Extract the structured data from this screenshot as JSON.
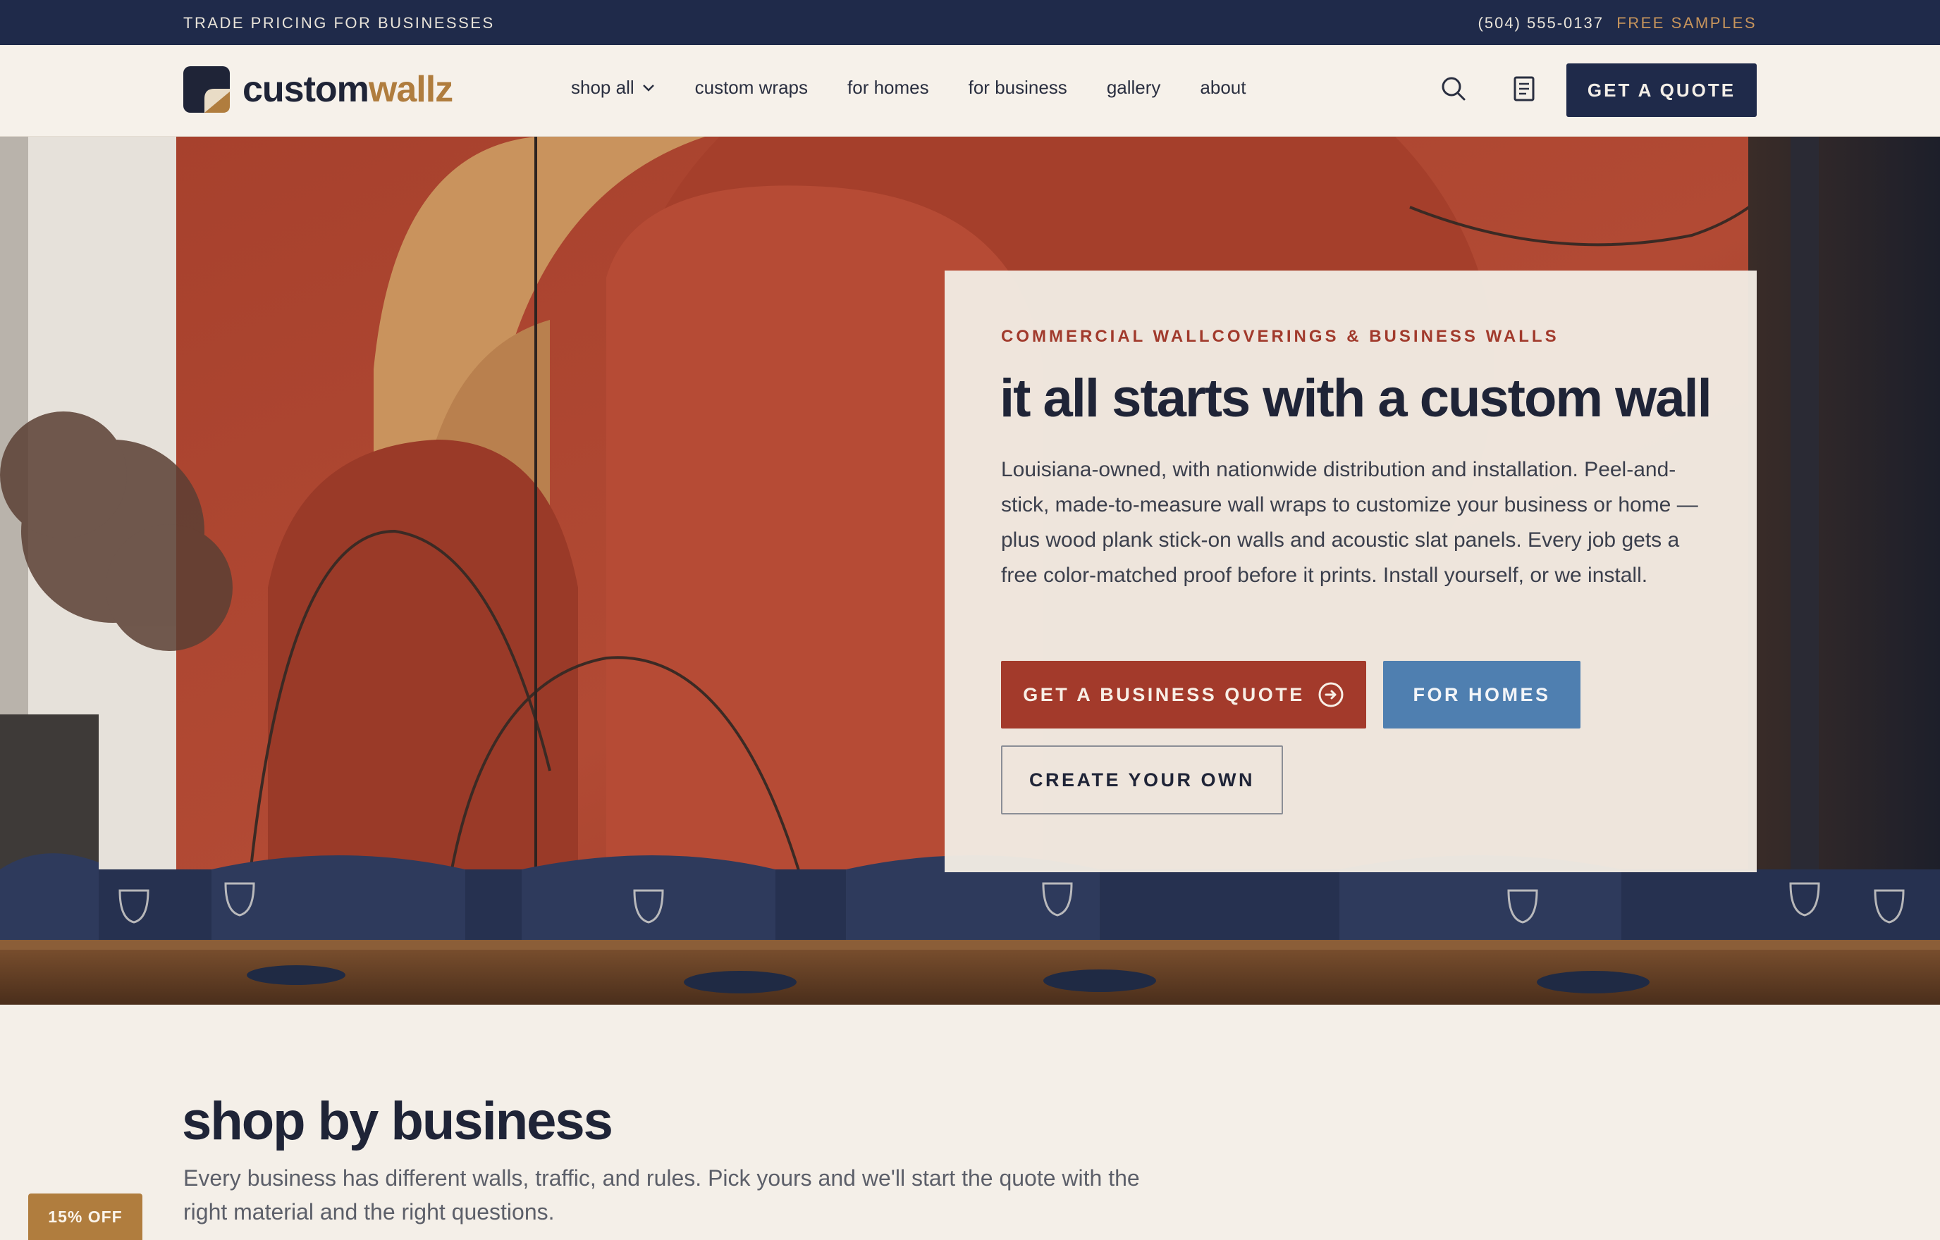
{
  "topbar": {
    "promo": "TRADE PRICING FOR BUSINESSES",
    "phone": "(504) 555-0137",
    "samples": "FREE SAMPLES"
  },
  "header": {
    "logo_part1": "custom",
    "logo_part2": "wallz",
    "nav": [
      "shop all",
      "custom wraps",
      "for homes",
      "for business",
      "gallery",
      "about"
    ],
    "quote_button": "GET A QUOTE",
    "icons": [
      "search-icon",
      "document-icon",
      "chevron-down-icon"
    ]
  },
  "hero": {
    "eyebrow": "COMMERCIAL WALLCOVERINGS & BUSINESS WALLS",
    "title": "it all starts with a custom wall",
    "body": "Louisiana-owned, with nationwide distribution and installation. Peel-and-stick, made-to-measure wall wraps to customize your business or home — plus wood plank stick-on walls and acoustic slat panels. Every job gets a free color-matched proof before it prints. Install yourself, or we install.",
    "btn_business": "GET A BUSINESS QUOTE",
    "btn_homes": "FOR HOMES",
    "btn_create": "CREATE YOUR OWN"
  },
  "section": {
    "title": "shop by business",
    "subtitle": "Every business has different walls, traffic, and rules. Pick yours and we'll start the quote with the right material and the right questions."
  },
  "badge": "15% OFF",
  "colors": {
    "navy": "#1f2a4a",
    "terracotta": "#a33a2b",
    "blue": "#4f7fb0",
    "gold": "#b07d3e",
    "cream": "#f4efe8"
  }
}
